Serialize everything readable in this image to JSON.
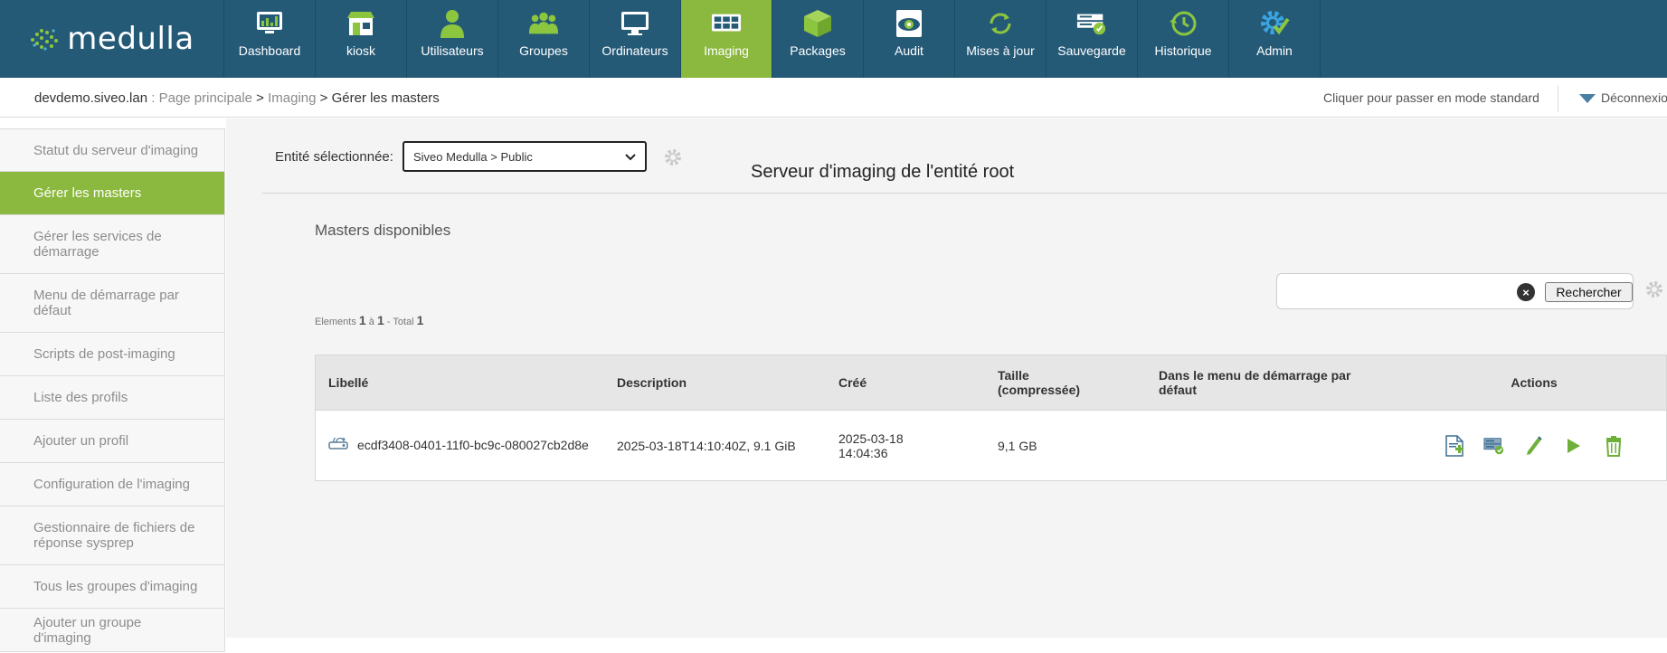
{
  "app": {
    "logo_text": "medulla",
    "brand_color": "#255a77",
    "accent_color": "#8bb83e"
  },
  "nav": {
    "items": [
      {
        "label": "Dashboard",
        "icon": "dashboard-icon"
      },
      {
        "label": "kiosk",
        "icon": "kiosk-icon"
      },
      {
        "label": "Utilisateurs",
        "icon": "user-icon"
      },
      {
        "label": "Groupes",
        "icon": "group-icon"
      },
      {
        "label": "Ordinateurs",
        "icon": "computer-icon"
      },
      {
        "label": "Imaging",
        "icon": "imaging-icon",
        "active": true
      },
      {
        "label": "Packages",
        "icon": "package-icon"
      },
      {
        "label": "Audit",
        "icon": "audit-icon"
      },
      {
        "label": "Mises à jour",
        "icon": "update-icon"
      },
      {
        "label": "Sauvegarde",
        "icon": "backup-icon"
      },
      {
        "label": "Historique",
        "icon": "history-icon"
      },
      {
        "label": "Admin",
        "icon": "admin-gear-icon"
      }
    ]
  },
  "breadcrumb": {
    "host": "devdemo.siveo.lan",
    "sep1": " : ",
    "home": "Page principale",
    "sep2": " > ",
    "section": "Imaging",
    "sep3": " > ",
    "current": "Gérer les masters"
  },
  "header": {
    "mode_link": "Cliquer pour passer en mode standard",
    "logout": "Déconnexion"
  },
  "sidebar": {
    "items": [
      {
        "label": "Statut du serveur d'imaging"
      },
      {
        "label": "Gérer les masters",
        "active": true
      },
      {
        "label": "Gérer les services de démarrage"
      },
      {
        "label": "Menu de démarrage par défaut"
      },
      {
        "label": "Scripts de post-imaging"
      },
      {
        "label": "Liste des profils"
      },
      {
        "label": "Ajouter un profil"
      },
      {
        "label": "Configuration de l'imaging"
      },
      {
        "label": "Gestionnaire de fichiers de réponse sysprep"
      },
      {
        "label": "Tous les groupes d'imaging"
      },
      {
        "label": "Ajouter un groupe d'imaging"
      }
    ]
  },
  "main": {
    "entity_label": "Entité sélectionnée:",
    "entity_selected": "Siveo Medulla > Public",
    "server_title": "Serveur d'imaging de l'entité root",
    "masters_title": "Masters disponibles",
    "search": {
      "value": "",
      "placeholder": "",
      "button": "Rechercher"
    },
    "pagination": {
      "prefix": "Elements",
      "from": "1",
      "to_word": "à",
      "to": "1",
      "total_word": "- Total",
      "total": "1"
    },
    "table": {
      "headers": {
        "label": "Libellé",
        "description": "Description",
        "created": "Créé",
        "size": "Taille (compressée)",
        "default_menu": "Dans le menu de démarrage par défaut",
        "actions": "Actions"
      },
      "rows": [
        {
          "label": "ecdf3408-0401-11f0-bc9c-080027cb2d8e",
          "description": "2025-03-18T14:10:40Z, 9.1 GiB",
          "created": "2025-03-18 14:04:36",
          "size": "9,1 GB",
          "default_menu": "",
          "actions": [
            "add-to-menu-icon",
            "server-deploy-icon",
            "edit-pencil-icon",
            "play-icon",
            "trash-icon"
          ]
        }
      ]
    }
  }
}
